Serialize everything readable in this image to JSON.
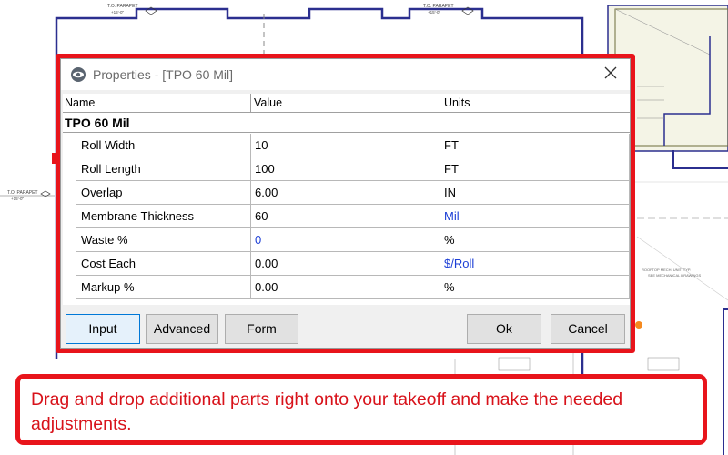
{
  "dialog": {
    "title": "Properties - [TPO 60 Mil]",
    "app_icon": "eye-logo-icon",
    "close_icon": "close-icon"
  },
  "grid": {
    "headers": {
      "name": "Name",
      "value": "Value",
      "units": "Units"
    },
    "group": "TPO 60 Mil",
    "rows": [
      {
        "name": "Roll Width",
        "value": "10",
        "units": "FT",
        "value_color": "#000000",
        "units_color": "#000000"
      },
      {
        "name": "Roll Length",
        "value": "100",
        "units": "FT",
        "value_color": "#000000",
        "units_color": "#000000"
      },
      {
        "name": "Overlap",
        "value": "6.00",
        "units": "IN",
        "value_color": "#000000",
        "units_color": "#000000"
      },
      {
        "name": "Membrane Thickness",
        "value": "60",
        "units": "Mil",
        "value_color": "#000000",
        "units_color": "#1d3fd6"
      },
      {
        "name": "Waste %",
        "value": "0",
        "units": "%",
        "value_color": "#1d3fd6",
        "units_color": "#000000"
      },
      {
        "name": "Cost Each",
        "value": "0.00",
        "units": "$/Roll",
        "value_color": "#000000",
        "units_color": "#1d3fd6"
      },
      {
        "name": "Markup %",
        "value": "0.00",
        "units": "%",
        "value_color": "#000000",
        "units_color": "#000000"
      }
    ]
  },
  "buttons": {
    "input": "Input",
    "advanced": "Advanced",
    "form": "Form",
    "ok": "Ok",
    "cancel": "Cancel"
  },
  "callout": {
    "text": "Drag and drop additional parts right onto your takeoff and make the needed adjustments."
  },
  "blueprint": {
    "annotations": [
      "T.O. PARAPET",
      "T.O. PARAPET",
      "T.O. PARAPET"
    ]
  },
  "colors": {
    "highlight": "#e8141b",
    "blueprint_line": "#2b2f8f",
    "blueprint_fill": "#f4f4e6",
    "link_blue": "#1d3fd6"
  }
}
